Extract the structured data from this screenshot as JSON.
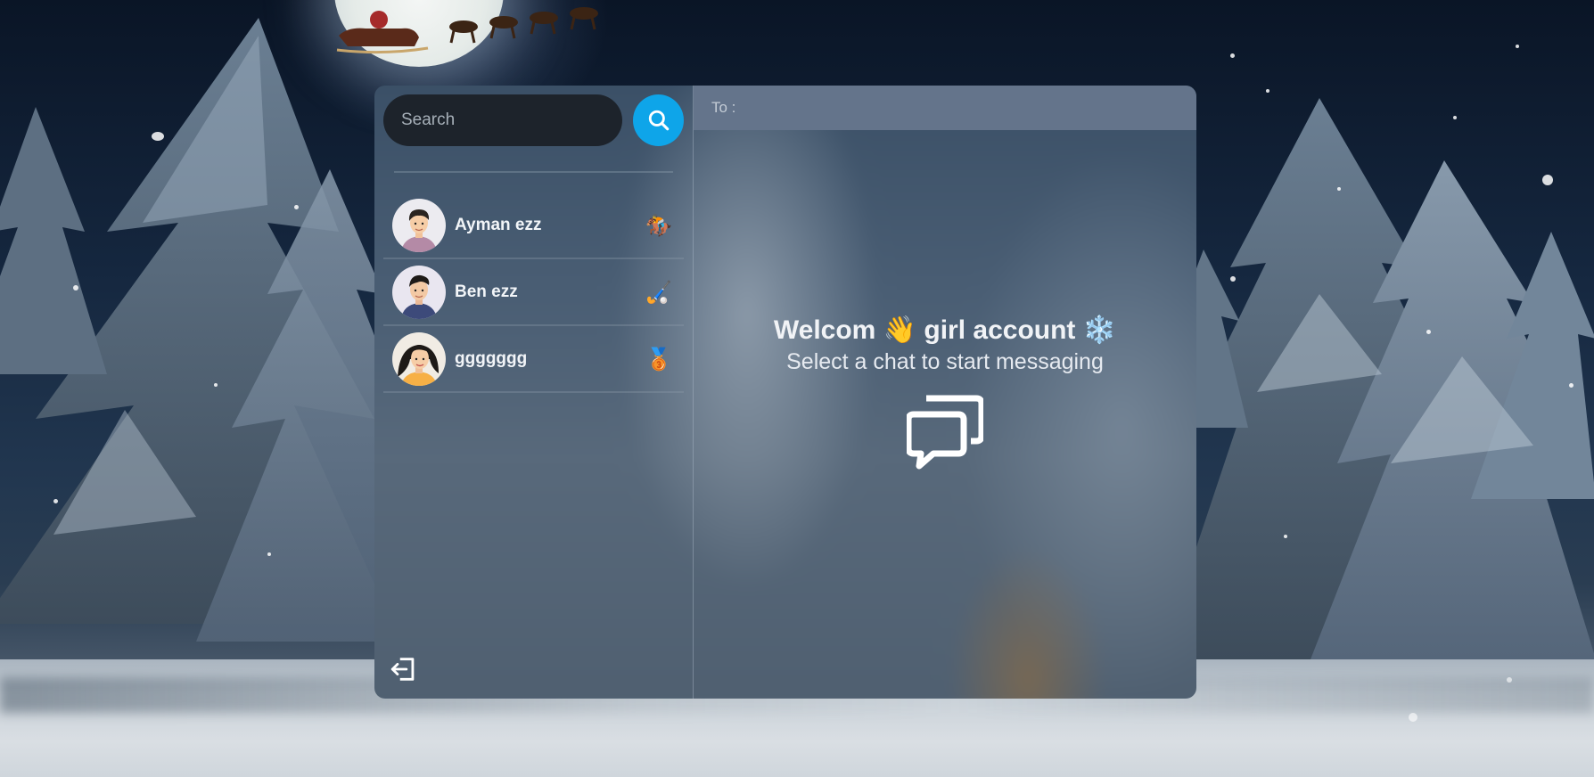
{
  "search": {
    "placeholder": "Search"
  },
  "conversations": [
    {
      "name": "Ayman ezz",
      "emoji": "🏇"
    },
    {
      "name": "Ben ezz",
      "emoji": "🏑"
    },
    {
      "name": "ggggggg",
      "emoji": "🥉"
    }
  ],
  "chat_header": {
    "to_label": "To :"
  },
  "welcome": {
    "greeting": "Welcom",
    "wave_emoji": "👋",
    "account": "girl account",
    "snow_emoji": "❄️",
    "subtitle": "Select a chat to start messaging"
  },
  "icons": {
    "search": "search-icon",
    "logout": "logout-icon",
    "chat": "chat-bubbles-icon"
  },
  "colors": {
    "search_button": "#0ea5e9",
    "search_input_bg": "#1d232b",
    "to_bar": "#64748b"
  }
}
